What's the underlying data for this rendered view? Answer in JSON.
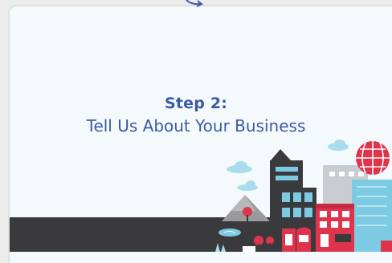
{
  "step": {
    "title": "Step 2:",
    "subtitle": "Tell Us About Your Business"
  },
  "colors": {
    "text": "#3b5aa5",
    "background": "#f4f9fc",
    "ground": "#3a3a3c",
    "accent_red": "#e0344d",
    "accent_blue": "#7ccbe2",
    "building_dark": "#3a3a3c",
    "building_gray": "#c9cdd1"
  },
  "icons": [
    "arrow-icon",
    "cityscape-illustration"
  ]
}
